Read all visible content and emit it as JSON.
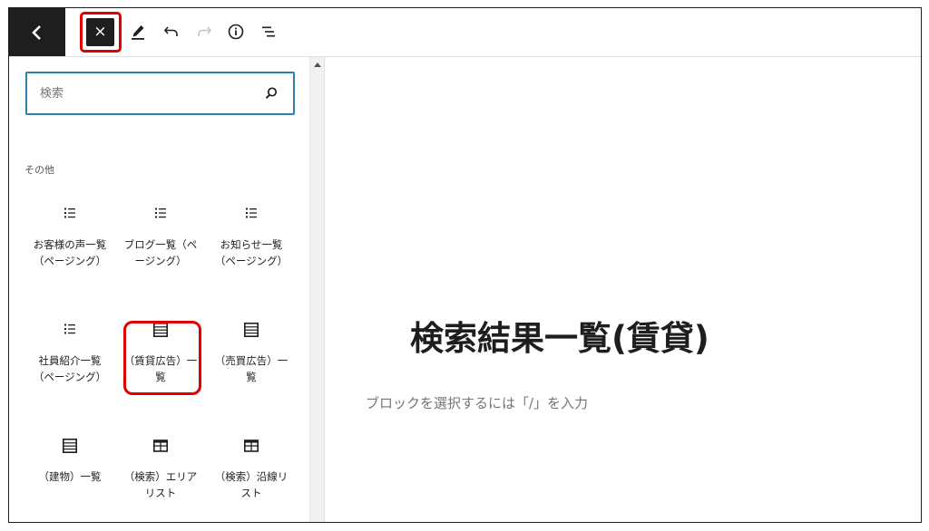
{
  "toolbar": {
    "back_icon": "chevron-left-icon",
    "close_icon": "close-icon",
    "close_symbol": "×",
    "tools_icon": "pencil-icon",
    "undo_icon": "undo-icon",
    "redo_icon": "redo-icon",
    "info_icon": "info-icon",
    "outline_icon": "list-view-icon"
  },
  "inserter": {
    "search": {
      "placeholder": "検索",
      "value": ""
    },
    "category": "その他",
    "blocks": [
      {
        "label": "お客様の声一覧（ページング）",
        "icon": "list-icon"
      },
      {
        "label": "ブログ一覧（ページング）",
        "icon": "list-icon"
      },
      {
        "label": "お知らせ一覧（ページング）",
        "icon": "list-icon"
      },
      {
        "label": "社員紹介一覧（ページング）",
        "icon": "list-icon"
      },
      {
        "label": "（賃貸広告）一覧",
        "icon": "table-list-icon"
      },
      {
        "label": "（売買広告）一覧",
        "icon": "table-list-icon"
      },
      {
        "label": "（建物）一覧",
        "icon": "table-list-icon"
      },
      {
        "label": "（検索）エリアリスト",
        "icon": "table-icon"
      },
      {
        "label": "（検索）沿線リスト",
        "icon": "table-icon"
      }
    ]
  },
  "editor": {
    "title": "検索結果一覧(賃貸)",
    "block_placeholder": "ブロックを選択するには「/」を入力"
  },
  "colors": {
    "highlight": "#e00000",
    "dark": "#1e1e1e",
    "focus": "#2f7fae"
  }
}
